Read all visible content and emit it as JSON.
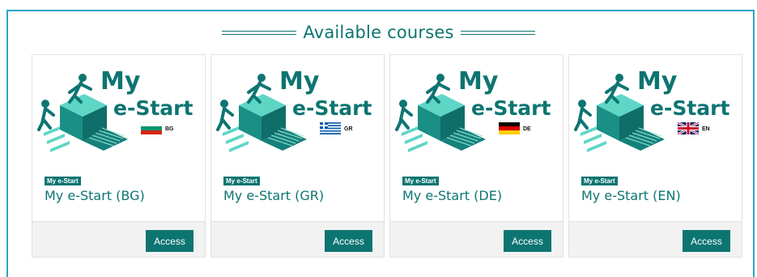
{
  "section": {
    "title": "Available courses"
  },
  "logo": {
    "word1": "My",
    "word2": "e-Start"
  },
  "brand_colors": {
    "primary": "#0d7571",
    "accent_light": "#5ed6c6",
    "frame": "#2aa5c9"
  },
  "courses": [
    {
      "tag": "My e-Start",
      "title": "My e-Start (BG)",
      "lang_code": "BG",
      "flag_icon": "bulgaria-flag-icon",
      "button": "Access"
    },
    {
      "tag": "My e-Start",
      "title": "My e-Start (GR)",
      "lang_code": "GR",
      "flag_icon": "greece-flag-icon",
      "button": "Access"
    },
    {
      "tag": "My e-Start",
      "title": "My e-Start (DE)",
      "lang_code": "DE",
      "flag_icon": "germany-flag-icon",
      "button": "Access"
    },
    {
      "tag": "My e-Start",
      "title": "My e-Start (EN)",
      "lang_code": "EN",
      "flag_icon": "uk-flag-icon",
      "button": "Access"
    }
  ]
}
